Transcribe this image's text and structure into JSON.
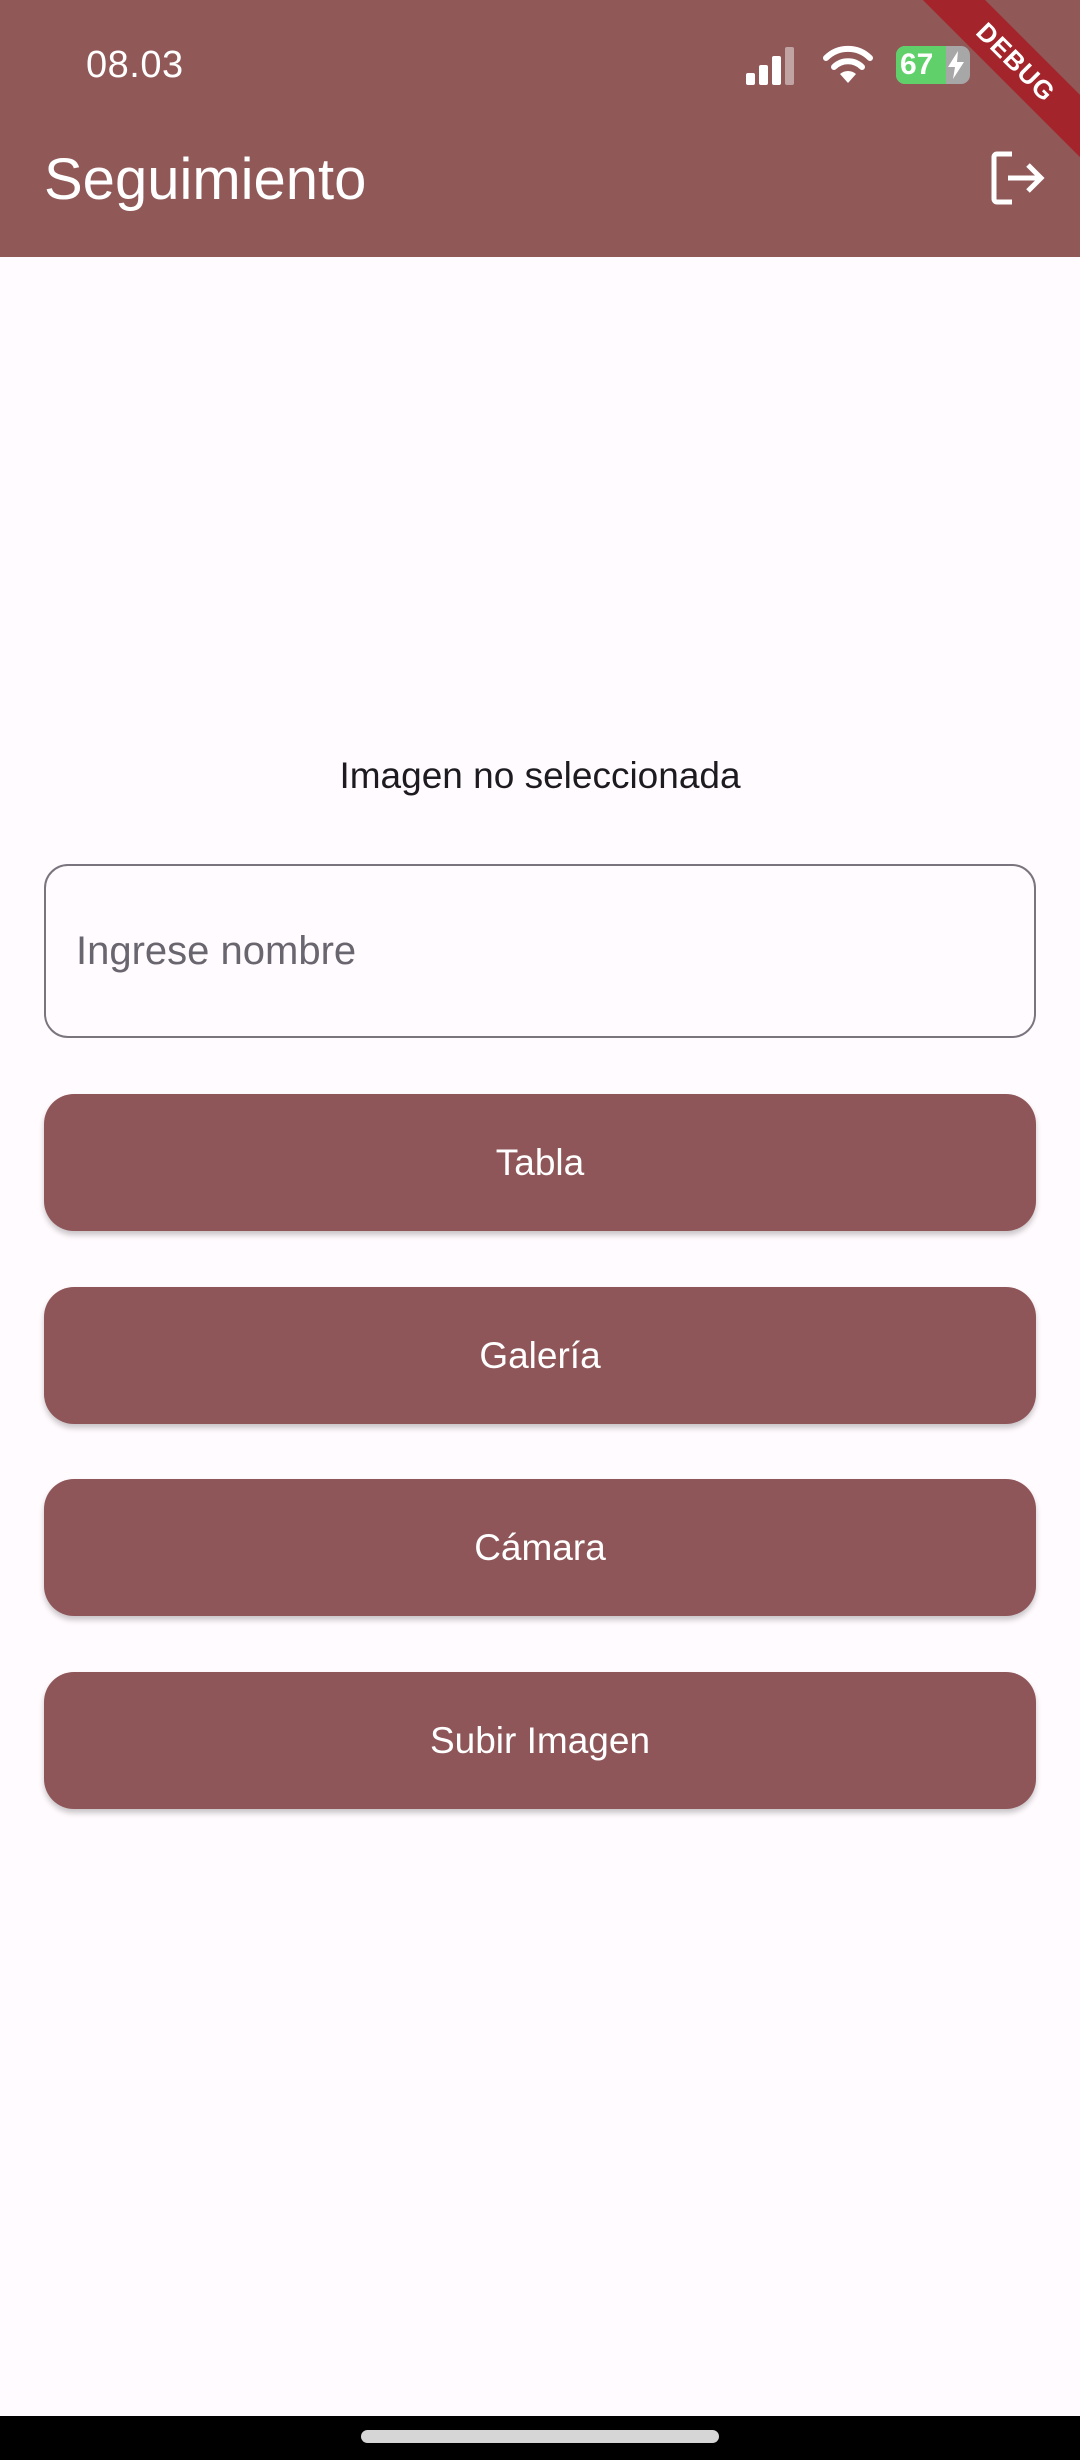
{
  "status_bar": {
    "time": "08.03",
    "battery_level": "67",
    "battery_fraction": 0.67
  },
  "debug_banner": "DEBUG",
  "app_bar": {
    "title": "Seguimiento",
    "action_icon": "logout-icon"
  },
  "main": {
    "image_status": "Imagen no seleccionada",
    "name_input": {
      "placeholder": "Ingrese nombre",
      "value": ""
    },
    "buttons": [
      {
        "label": "Tabla"
      },
      {
        "label": "Galería"
      },
      {
        "label": "Cámara"
      },
      {
        "label": "Subir Imagen"
      }
    ]
  },
  "colors": {
    "primary": "#915858",
    "button": "#8f5659",
    "background": "#fffbfe",
    "debug_ribbon": "#a3242a",
    "battery": "#5fd06a"
  }
}
